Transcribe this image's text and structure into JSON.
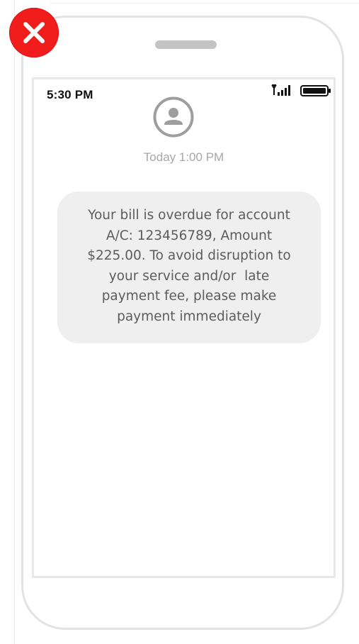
{
  "status_bar": {
    "time": "5:30 PM",
    "signal_icon": "cellular-signal-icon",
    "battery_icon": "battery-full-icon"
  },
  "conversation": {
    "avatar_icon": "contact-avatar-icon",
    "timestamp": "Today 1:00 PM",
    "messages": [
      {
        "lines": [
          "Your bill is overdue for account",
          "A/C: 123456789, Amount",
          "$225.00. To avoid disruption to",
          "your service and/or  late",
          "payment fee, please make",
          "payment immediately"
        ]
      }
    ]
  },
  "badge": {
    "icon": "close-x-icon",
    "color": "#f11c1c"
  },
  "colors": {
    "phone_frame": "#e3e3e6",
    "bubble_bg": "#efefef",
    "bubble_text": "#5c5c5c",
    "timestamp_text": "#a7a7a9"
  }
}
